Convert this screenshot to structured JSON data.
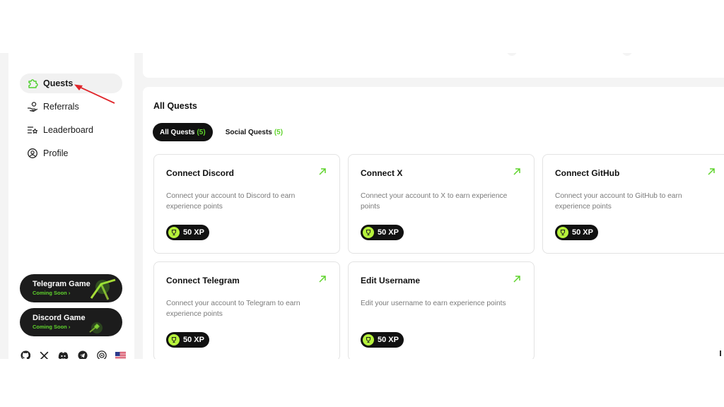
{
  "sidebar": {
    "items": [
      {
        "label": "Quests",
        "icon": "puzzle-icon",
        "active": true
      },
      {
        "label": "Referrals",
        "icon": "hand-coin-icon",
        "active": false
      },
      {
        "label": "Leaderboard",
        "icon": "list-star-icon",
        "active": false
      },
      {
        "label": "Profile",
        "icon": "user-circle-icon",
        "active": false
      }
    ],
    "games": [
      {
        "title": "Telegram Game",
        "status": "Coming Soon"
      },
      {
        "title": "Discord Game",
        "status": "Coming Soon"
      }
    ],
    "socials": [
      "github-icon",
      "x-icon",
      "discord-icon",
      "telegram-icon",
      "globe-icon",
      "us-flag-icon"
    ]
  },
  "main": {
    "section_title": "All Quests",
    "tabs": [
      {
        "label": "All Quests",
        "count": "(5)",
        "active": true
      },
      {
        "label": "Social Quests",
        "count": "(5)",
        "active": false
      }
    ],
    "quests": [
      {
        "title": "Connect Discord",
        "description": "Connect your account to Discord to earn experience points",
        "xp": "50 XP"
      },
      {
        "title": "Connect X",
        "description": "Connect your account to X to earn experience points",
        "xp": "50 XP"
      },
      {
        "title": "Connect GitHub",
        "description": "Connect your account to GitHub to earn experience points",
        "xp": "50 XP"
      },
      {
        "title": "Connect Telegram",
        "description": "Connect your account to Telegram to earn experience points",
        "xp": "50 XP"
      },
      {
        "title": "Edit Username",
        "description": "Edit your username to earn experience points",
        "xp": "50 XP"
      }
    ]
  },
  "colors": {
    "accent": "#5fd32c",
    "coin": "#b6f23b",
    "annotation_arrow": "#e0262b"
  }
}
